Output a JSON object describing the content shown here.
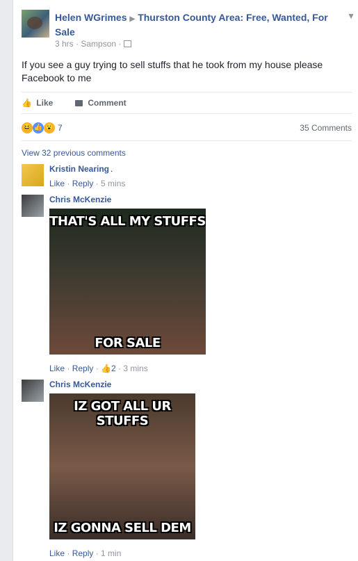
{
  "post": {
    "author": "Helen WGrimes",
    "group": "Thurston County Area: Free, Wanted, For Sale",
    "time": "3 hrs",
    "location": "Sampson",
    "text": "If you see a guy trying to sell stuffs that he took from my house please Facebook to me"
  },
  "actions": {
    "like": "Like",
    "comment": "Comment"
  },
  "reactions": {
    "count": "7",
    "comments_count": "35 Comments"
  },
  "view_previous": "View 32 previous comments",
  "comments": [
    {
      "name": "Kristin Nearing",
      "suffix": ".",
      "like": "Like",
      "reply": "Reply",
      "time": "5 mins"
    },
    {
      "name": "Chris McKenzie",
      "meme_top": "THAT'S ALL MY STUFFS",
      "meme_bottom": "FOR SALE",
      "like": "Like",
      "reply": "Reply",
      "likes": "2",
      "time": "3 mins"
    },
    {
      "name": "Chris McKenzie",
      "meme_top": "IZ GOT ALL UR STUFFS",
      "meme_bottom": "IZ GONNA SELL DEM",
      "like": "Like",
      "reply": "Reply",
      "time": "1 min"
    }
  ],
  "colors": {
    "link": "#365899",
    "meta": "#90949c",
    "background": "#e9ebee"
  }
}
